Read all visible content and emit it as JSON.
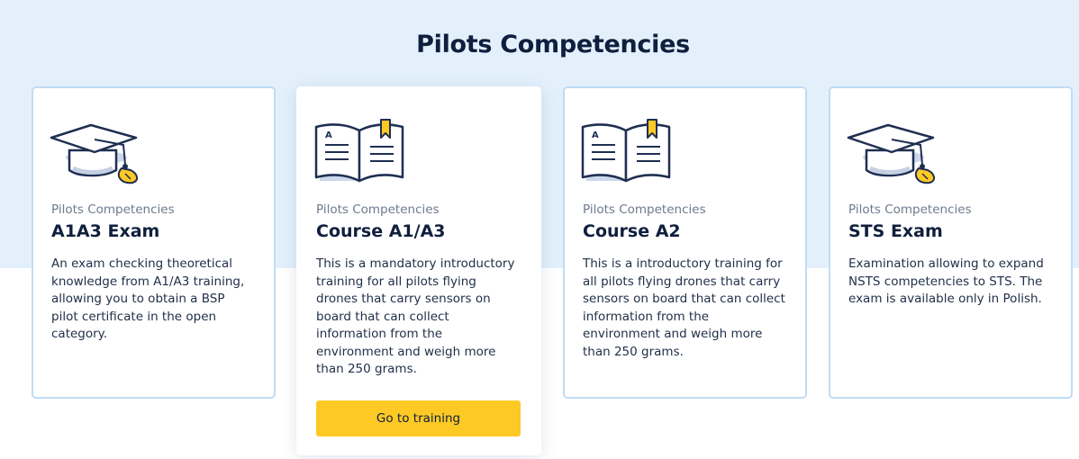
{
  "section": {
    "title": "Pilots Competencies"
  },
  "cards": [
    {
      "icon": "graduation-cap-icon",
      "category": "Pilots Competencies",
      "title": "A1A3 Exam",
      "description": "An exam checking theoretical knowledge from A1/A3 training, allowing you to obtain a BSP pilot certificate in the open category."
    },
    {
      "icon": "open-book-icon",
      "category": "Pilots Competencies",
      "title": "Course A1/A3",
      "description": "This is a mandatory introductory training for all pilots flying drones that carry sensors on board that can collect information from the environment and weigh more than 250 grams.",
      "button_label": "Go to training"
    },
    {
      "icon": "open-book-icon",
      "category": "Pilots Competencies",
      "title": "Course A2",
      "description": "This is a introductory training for all pilots flying drones that carry sensors on board that can collect information from the environment and weigh more than 250 grams."
    },
    {
      "icon": "graduation-cap-icon",
      "category": "Pilots Competencies",
      "title": "STS Exam",
      "description": "Examination allowing to expand NSTS competencies to STS. The exam is available only in Polish."
    }
  ],
  "colors": {
    "band": "#e3f0fc",
    "card_border": "#bfdcf5",
    "accent_button": "#fdc925",
    "heading": "#0f1f3d"
  }
}
